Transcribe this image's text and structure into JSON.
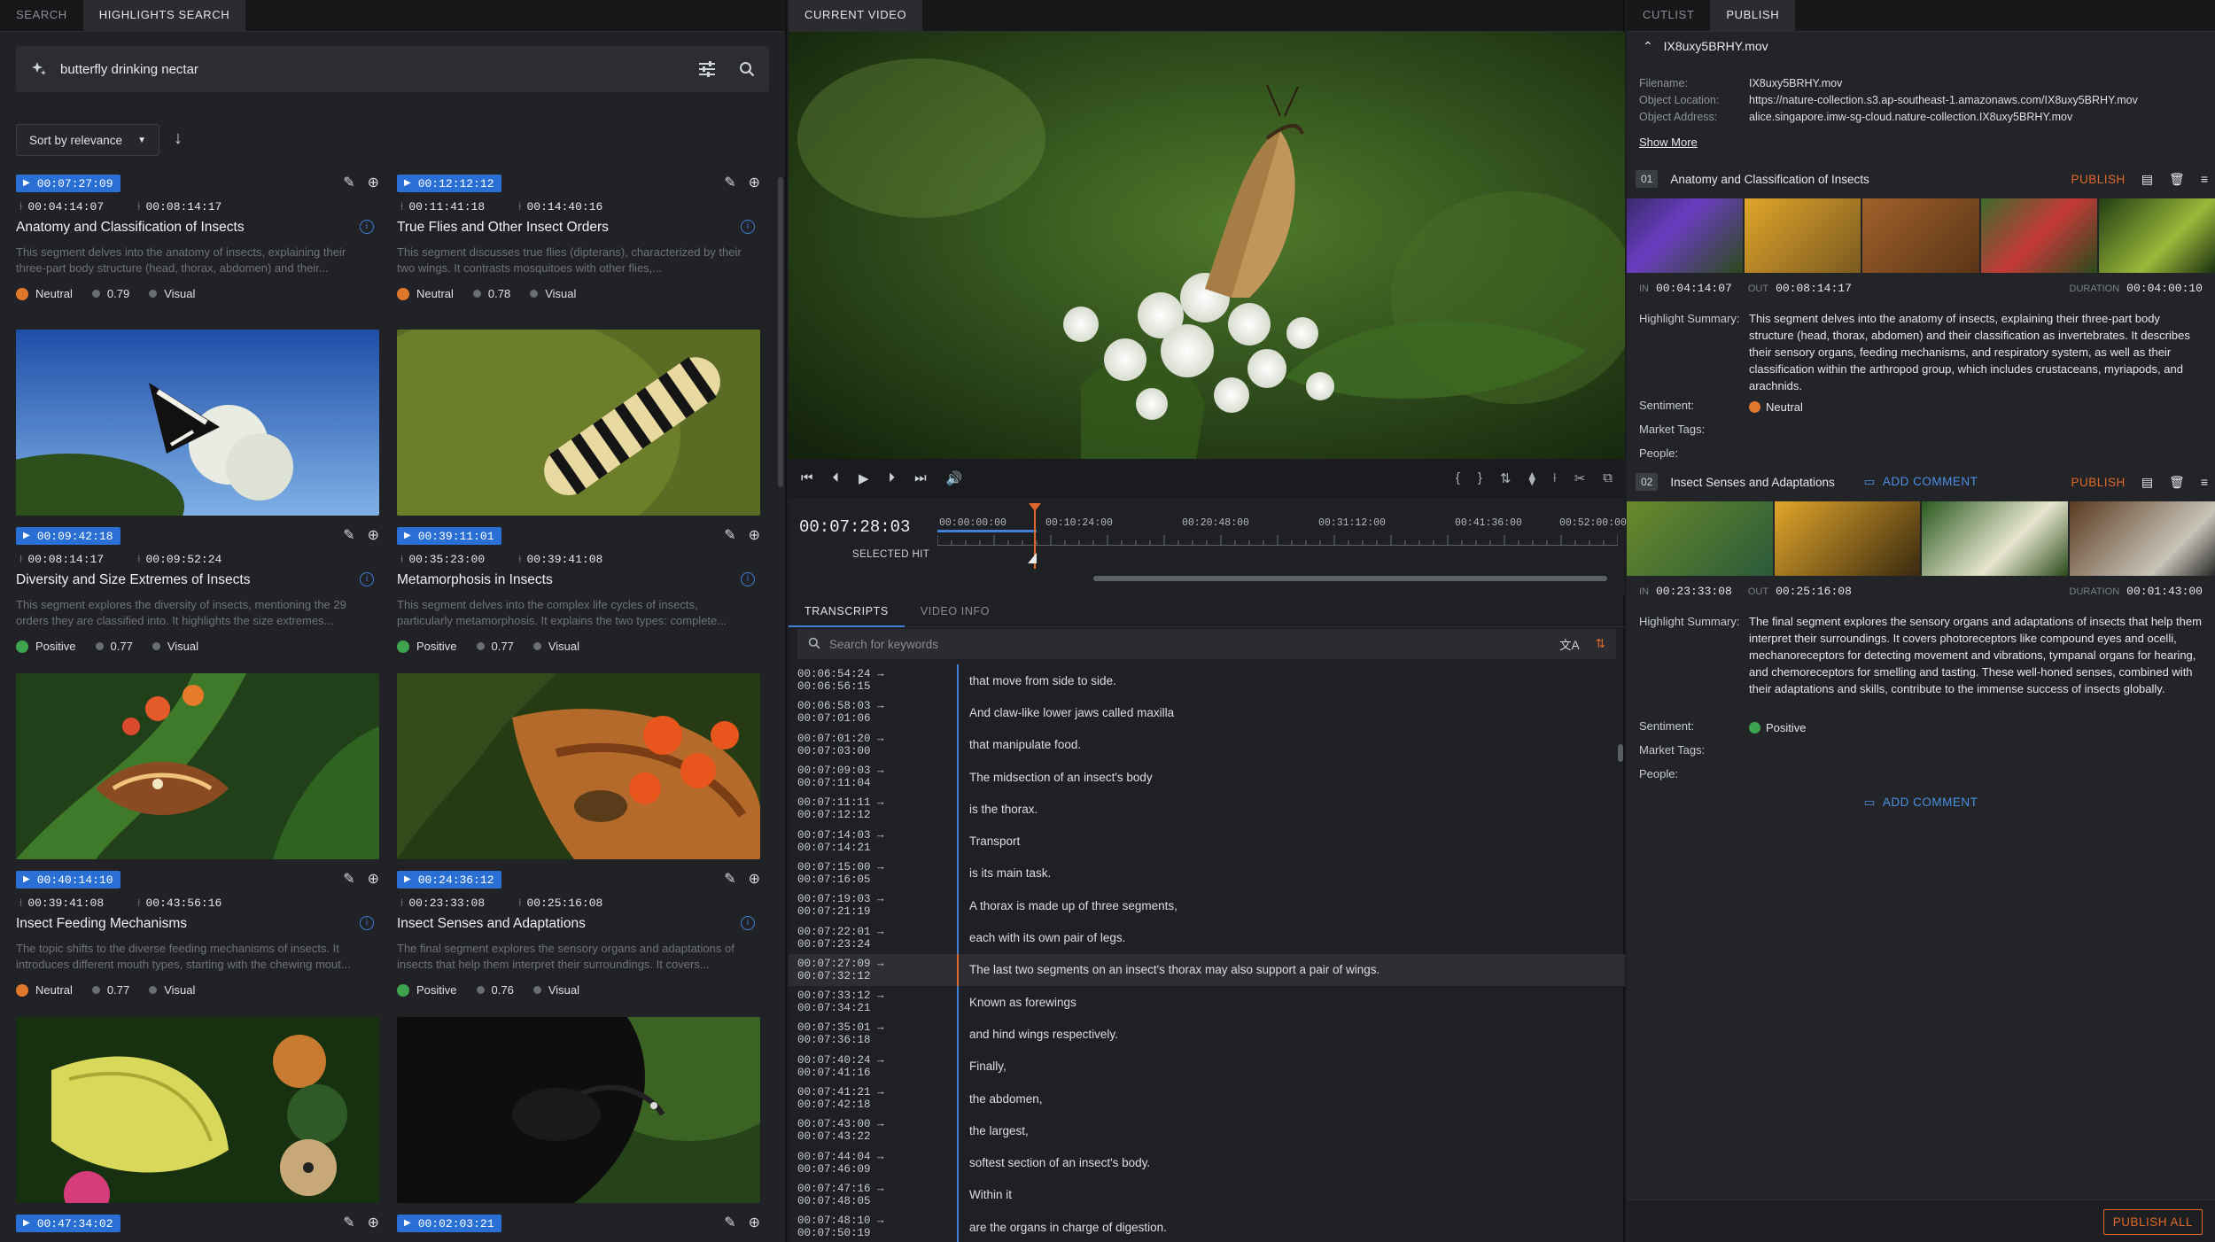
{
  "left": {
    "tabs": [
      "SEARCH",
      "HIGHLIGHTS SEARCH"
    ],
    "query": "butterfly drinking nectar",
    "sort_label": "Sort by relevance",
    "cards": [
      {
        "tc": "00:07:27:09",
        "in": "00:04:14:07",
        "out": "00:08:14:17",
        "title": "Anatomy and Classification of Insects",
        "desc": "This segment delves into the anatomy of insects, explaining their three-part body structure (head, thorax, abdomen) and their...",
        "sentiment": "Neutral",
        "score": "0.79",
        "type": "Visual"
      },
      {
        "tc": "00:12:12:12",
        "in": "00:11:41:18",
        "out": "00:14:40:16",
        "title": "True Flies and Other Insect Orders",
        "desc": "This segment discusses true flies (dipterans), characterized by their two wings. It contrasts mosquitoes with other flies,...",
        "sentiment": "Neutral",
        "score": "0.78",
        "type": "Visual"
      },
      {
        "tc": "00:09:42:18",
        "in": "00:08:14:17",
        "out": "00:09:52:24",
        "title": "Diversity and Size Extremes of Insects",
        "desc": "This segment explores the diversity of insects, mentioning the 29 orders they are classified into. It highlights the size extremes...",
        "sentiment": "Positive",
        "score": "0.77",
        "type": "Visual"
      },
      {
        "tc": "00:39:11:01",
        "in": "00:35:23:00",
        "out": "00:39:41:08",
        "title": "Metamorphosis in Insects",
        "desc": "This segment delves into the complex life cycles of insects, particularly metamorphosis. It explains the two types: complete...",
        "sentiment": "Positive",
        "score": "0.77",
        "type": "Visual"
      },
      {
        "tc": "00:40:14:10",
        "in": "00:39:41:08",
        "out": "00:43:56:16",
        "title": "Insect Feeding Mechanisms",
        "desc": "The topic shifts to the diverse feeding mechanisms of insects. It introduces different mouth types, starting with the chewing mout...",
        "sentiment": "Neutral",
        "score": "0.77",
        "type": "Visual"
      },
      {
        "tc": "00:24:36:12",
        "in": "00:23:33:08",
        "out": "00:25:16:08",
        "title": "Insect Senses and Adaptations",
        "desc": "The final segment explores the sensory organs and adaptations of insects that help them interpret their surroundings. It covers...",
        "sentiment": "Positive",
        "score": "0.76",
        "type": "Visual"
      },
      {
        "tc": "00:47:34:02"
      },
      {
        "tc": "00:02:03:21"
      }
    ]
  },
  "mid": {
    "tab": "CURRENT VIDEO",
    "current_time": "00:07:28:03",
    "timeline_labels": [
      "00:00:00:00",
      "00:10:24:00",
      "00:20:48:00",
      "00:31:12:00",
      "00:41:36:00",
      "00:52:00:00"
    ],
    "selected_hit": "SELECTED HIT",
    "tabs": [
      "TRANSCRIPTS",
      "VIDEO INFO"
    ],
    "search_placeholder": "Search for keywords",
    "transcripts": [
      {
        "t": "00:06:54:24 → 00:06:56:15",
        "text": "that move from side to side."
      },
      {
        "t": "00:06:58:03 → 00:07:01:06",
        "text": "And claw-like lower jaws called maxilla"
      },
      {
        "t": "00:07:01:20 → 00:07:03:00",
        "text": "that manipulate food."
      },
      {
        "t": "00:07:09:03 → 00:07:11:04",
        "text": "The midsection of an insect's body"
      },
      {
        "t": "00:07:11:11 → 00:07:12:12",
        "text": "is the thorax."
      },
      {
        "t": "00:07:14:03 → 00:07:14:21",
        "text": "Transport"
      },
      {
        "t": "00:07:15:00 → 00:07:16:05",
        "text": "is its main task."
      },
      {
        "t": "00:07:19:03 → 00:07:21:19",
        "text": "A thorax is made up of three segments,"
      },
      {
        "t": "00:07:22:01 → 00:07:23:24",
        "text": "each with its own pair of legs."
      },
      {
        "t": "00:07:27:09 → 00:07:32:12",
        "text": "The last two segments on an insect's thorax may also support a pair of wings."
      },
      {
        "t": "00:07:33:12 → 00:07:34:21",
        "text": "Known as forewings"
      },
      {
        "t": "00:07:35:01 → 00:07:36:18",
        "text": "and hind wings respectively."
      },
      {
        "t": "00:07:40:24 → 00:07:41:16",
        "text": "Finally,"
      },
      {
        "t": "00:07:41:21 → 00:07:42:18",
        "text": "the abdomen,"
      },
      {
        "t": "00:07:43:00 → 00:07:43:22",
        "text": "the largest,"
      },
      {
        "t": "00:07:44:04 → 00:07:46:09",
        "text": "softest section of an insect's body."
      },
      {
        "t": "00:07:47:16 → 00:07:48:05",
        "text": "Within it"
      },
      {
        "t": "00:07:48:10 → 00:07:50:19",
        "text": "are the organs in charge of digestion."
      }
    ]
  },
  "right": {
    "tabs": [
      "CUTLIST",
      "PUBLISH"
    ],
    "file_title": "IX8uxy5BRHY.mov",
    "filename_k": "Filename:",
    "filename_v": "IX8uxy5BRHY.mov",
    "location_k": "Object Location:",
    "location_v": "https://nature-collection.s3.ap-southeast-1.amazonaws.com/IX8uxy5BRHY.mov",
    "address_k": "Object Address:",
    "address_v": "alice.singapore.imw-sg-cloud.nature-collection.IX8uxy5BRHY.mov",
    "show_more": "Show More",
    "publish": "PUBLISH",
    "in": "IN",
    "out": "OUT",
    "duration": "DURATION",
    "highlight_k": "Highlight Summary:",
    "sentiment_k": "Sentiment:",
    "market_k": "Market Tags:",
    "people_k": "People:",
    "add_comment": "ADD COMMENT",
    "publish_all": "PUBLISH ALL",
    "segments": [
      {
        "num": "01",
        "title": "Anatomy and Classification of Insects",
        "in": "00:04:14:07",
        "out": "00:08:14:17",
        "dur": "00:04:00:10",
        "summary": "This segment delves into the anatomy of insects, explaining their three-part body structure (head, thorax, abdomen) and their classification as invertebrates. It describes their sensory organs, feeding mechanisms, and respiratory system, as well as their classification within the arthropod group, which includes crustaceans, myriapods, and arachnids.",
        "sentiment": "Neutral"
      },
      {
        "num": "02",
        "title": "Insect Senses and Adaptations",
        "in": "00:23:33:08",
        "out": "00:25:16:08",
        "dur": "00:01:43:00",
        "summary": "The final segment explores the sensory organs and adaptations of insects that help them interpret their surroundings. It covers photoreceptors like compound eyes and ocelli, mechanoreceptors for detecting movement and vibrations, tympanal organs for hearing, and chemoreceptors for smelling and tasting. These well-honed senses, combined with their adaptations and skills, contribute to the immense success of insects globally.",
        "sentiment": "Positive"
      }
    ]
  }
}
